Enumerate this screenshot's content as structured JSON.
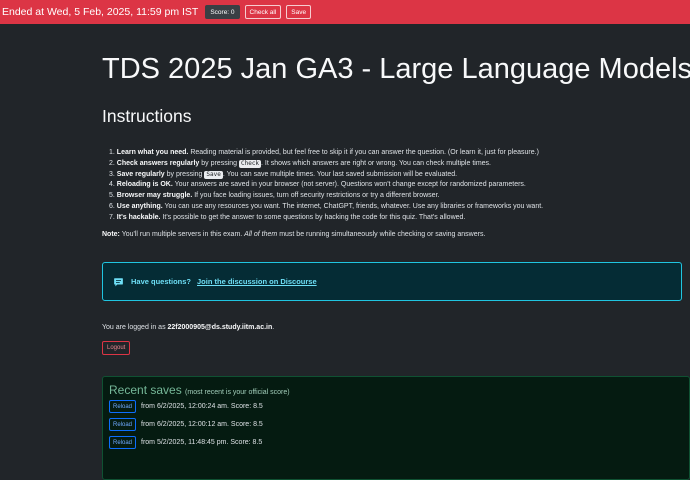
{
  "topbar": {
    "status": "Ended at Wed, 5 Feb, 2025, 11:59 pm IST",
    "score_label": "Score: 0",
    "check_all_label": "Check all",
    "save_label": "Save"
  },
  "page": {
    "title": "TDS 2025 Jan GA3 - Large Language Models",
    "instructions_heading": "Instructions"
  },
  "instructions": [
    {
      "bold": "Learn what you need.",
      "text": " Reading material is provided, but feel free to skip it if you can answer the question. (Or learn it, just for pleasure.)"
    },
    {
      "bold": "Check answers regularly",
      "pre": " by pressing ",
      "kbd": "Check",
      "text": ". It shows which answers are right or wrong. You can check multiple times."
    },
    {
      "bold": "Save regularly",
      "pre": " by pressing ",
      "kbd": "Save",
      "text": ". You can save multiple times. Your last saved submission will be evaluated."
    },
    {
      "bold": "Reloading is OK.",
      "text": " Your answers are saved in your browser (not server). Questions won't change except for randomized parameters."
    },
    {
      "bold": "Browser may struggle.",
      "text": " If you face loading issues, turn off security restrictions or try a different browser."
    },
    {
      "bold": "Use anything.",
      "text": " You can use any resources you want. The internet, ChatGPT, friends, whatever. Use any libraries or frameworks you want."
    },
    {
      "bold": "It's hackable.",
      "text": " It's possible to get the answer to some questions by hacking the code for this quiz. That's allowed."
    }
  ],
  "note": {
    "label": "Note:",
    "text_a": " You'll run multiple servers in this exam. ",
    "emph": "All of them",
    "text_b": " must be running simultaneously while checking or saving answers."
  },
  "discussion": {
    "icon": "chat-icon",
    "question": "Have questions?",
    "link_text": "Join the discussion on Discourse"
  },
  "login": {
    "prefix": "You are logged in as ",
    "email": "22f2000905@ds.study.iitm.ac.in",
    "suffix": ".",
    "logout_label": "Logout"
  },
  "saves": {
    "title": "Recent saves",
    "subtitle": "(most recent is your official score)",
    "reload_label": "Reload",
    "items": [
      "from 6/2/2025, 12:00:24 am. Score: 8.5",
      "from 6/2/2025, 12:00:12 am. Score: 8.5",
      "from 5/2/2025, 11:48:45 pm. Score: 8.5"
    ]
  },
  "colors": {
    "topbar": "#dc3545",
    "background": "#212529",
    "info_border": "#20c5e0",
    "success_bg": "#051b11"
  }
}
